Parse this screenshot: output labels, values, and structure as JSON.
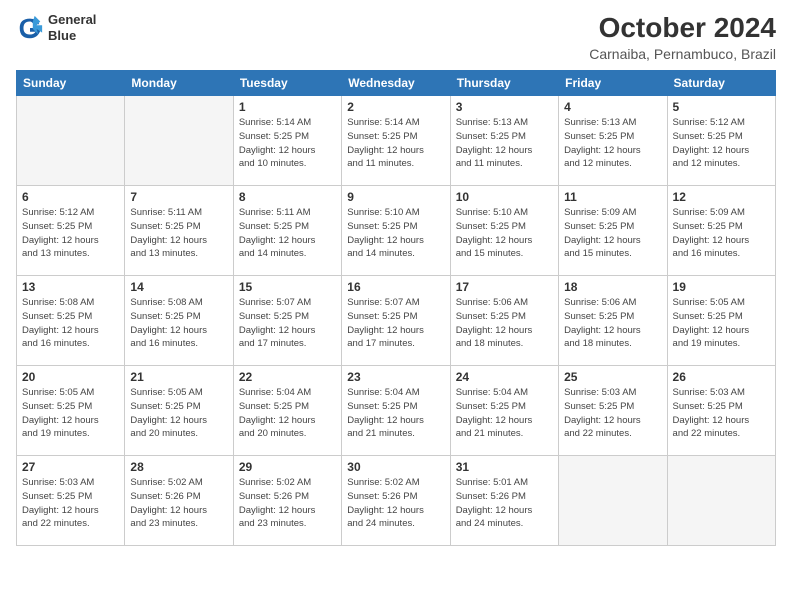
{
  "logo": {
    "line1": "General",
    "line2": "Blue"
  },
  "title": "October 2024",
  "subtitle": "Carnaiba, Pernambuco, Brazil",
  "headers": [
    "Sunday",
    "Monday",
    "Tuesday",
    "Wednesday",
    "Thursday",
    "Friday",
    "Saturday"
  ],
  "weeks": [
    [
      {
        "num": "",
        "info": ""
      },
      {
        "num": "",
        "info": ""
      },
      {
        "num": "1",
        "info": "Sunrise: 5:14 AM\nSunset: 5:25 PM\nDaylight: 12 hours\nand 10 minutes."
      },
      {
        "num": "2",
        "info": "Sunrise: 5:14 AM\nSunset: 5:25 PM\nDaylight: 12 hours\nand 11 minutes."
      },
      {
        "num": "3",
        "info": "Sunrise: 5:13 AM\nSunset: 5:25 PM\nDaylight: 12 hours\nand 11 minutes."
      },
      {
        "num": "4",
        "info": "Sunrise: 5:13 AM\nSunset: 5:25 PM\nDaylight: 12 hours\nand 12 minutes."
      },
      {
        "num": "5",
        "info": "Sunrise: 5:12 AM\nSunset: 5:25 PM\nDaylight: 12 hours\nand 12 minutes."
      }
    ],
    [
      {
        "num": "6",
        "info": "Sunrise: 5:12 AM\nSunset: 5:25 PM\nDaylight: 12 hours\nand 13 minutes."
      },
      {
        "num": "7",
        "info": "Sunrise: 5:11 AM\nSunset: 5:25 PM\nDaylight: 12 hours\nand 13 minutes."
      },
      {
        "num": "8",
        "info": "Sunrise: 5:11 AM\nSunset: 5:25 PM\nDaylight: 12 hours\nand 14 minutes."
      },
      {
        "num": "9",
        "info": "Sunrise: 5:10 AM\nSunset: 5:25 PM\nDaylight: 12 hours\nand 14 minutes."
      },
      {
        "num": "10",
        "info": "Sunrise: 5:10 AM\nSunset: 5:25 PM\nDaylight: 12 hours\nand 15 minutes."
      },
      {
        "num": "11",
        "info": "Sunrise: 5:09 AM\nSunset: 5:25 PM\nDaylight: 12 hours\nand 15 minutes."
      },
      {
        "num": "12",
        "info": "Sunrise: 5:09 AM\nSunset: 5:25 PM\nDaylight: 12 hours\nand 16 minutes."
      }
    ],
    [
      {
        "num": "13",
        "info": "Sunrise: 5:08 AM\nSunset: 5:25 PM\nDaylight: 12 hours\nand 16 minutes."
      },
      {
        "num": "14",
        "info": "Sunrise: 5:08 AM\nSunset: 5:25 PM\nDaylight: 12 hours\nand 16 minutes."
      },
      {
        "num": "15",
        "info": "Sunrise: 5:07 AM\nSunset: 5:25 PM\nDaylight: 12 hours\nand 17 minutes."
      },
      {
        "num": "16",
        "info": "Sunrise: 5:07 AM\nSunset: 5:25 PM\nDaylight: 12 hours\nand 17 minutes."
      },
      {
        "num": "17",
        "info": "Sunrise: 5:06 AM\nSunset: 5:25 PM\nDaylight: 12 hours\nand 18 minutes."
      },
      {
        "num": "18",
        "info": "Sunrise: 5:06 AM\nSunset: 5:25 PM\nDaylight: 12 hours\nand 18 minutes."
      },
      {
        "num": "19",
        "info": "Sunrise: 5:05 AM\nSunset: 5:25 PM\nDaylight: 12 hours\nand 19 minutes."
      }
    ],
    [
      {
        "num": "20",
        "info": "Sunrise: 5:05 AM\nSunset: 5:25 PM\nDaylight: 12 hours\nand 19 minutes."
      },
      {
        "num": "21",
        "info": "Sunrise: 5:05 AM\nSunset: 5:25 PM\nDaylight: 12 hours\nand 20 minutes."
      },
      {
        "num": "22",
        "info": "Sunrise: 5:04 AM\nSunset: 5:25 PM\nDaylight: 12 hours\nand 20 minutes."
      },
      {
        "num": "23",
        "info": "Sunrise: 5:04 AM\nSunset: 5:25 PM\nDaylight: 12 hours\nand 21 minutes."
      },
      {
        "num": "24",
        "info": "Sunrise: 5:04 AM\nSunset: 5:25 PM\nDaylight: 12 hours\nand 21 minutes."
      },
      {
        "num": "25",
        "info": "Sunrise: 5:03 AM\nSunset: 5:25 PM\nDaylight: 12 hours\nand 22 minutes."
      },
      {
        "num": "26",
        "info": "Sunrise: 5:03 AM\nSunset: 5:25 PM\nDaylight: 12 hours\nand 22 minutes."
      }
    ],
    [
      {
        "num": "27",
        "info": "Sunrise: 5:03 AM\nSunset: 5:25 PM\nDaylight: 12 hours\nand 22 minutes."
      },
      {
        "num": "28",
        "info": "Sunrise: 5:02 AM\nSunset: 5:26 PM\nDaylight: 12 hours\nand 23 minutes."
      },
      {
        "num": "29",
        "info": "Sunrise: 5:02 AM\nSunset: 5:26 PM\nDaylight: 12 hours\nand 23 minutes."
      },
      {
        "num": "30",
        "info": "Sunrise: 5:02 AM\nSunset: 5:26 PM\nDaylight: 12 hours\nand 24 minutes."
      },
      {
        "num": "31",
        "info": "Sunrise: 5:01 AM\nSunset: 5:26 PM\nDaylight: 12 hours\nand 24 minutes."
      },
      {
        "num": "",
        "info": ""
      },
      {
        "num": "",
        "info": ""
      }
    ]
  ]
}
